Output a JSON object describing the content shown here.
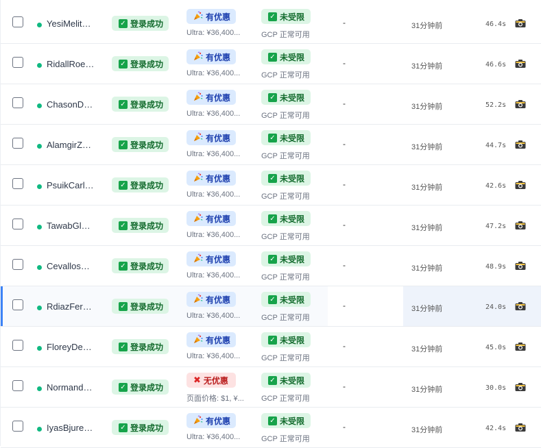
{
  "columns": {
    "login_icon": "check-icon",
    "promo_icon": "party-popper-icon",
    "nopromo_icon": "cross-mark-icon",
    "limit_icon": "check-icon",
    "screenshot_icon": "camera-icon"
  },
  "colors": {
    "status_dot": "#10b981",
    "success_bg": "#dcf5e5",
    "success_text": "#146c2e",
    "promo_bg": "#dbeafe",
    "promo_text": "#1e40af",
    "nopromo_bg": "#fde2e2",
    "nopromo_text": "#b91c1c",
    "selected_bar": "#3b82f6"
  },
  "rows": [
    {
      "name": "YesiMelit…",
      "login": "登录成功",
      "promo": "有优惠",
      "has_promo": true,
      "price": "Ultra: ¥36,400...",
      "limit": "未受限",
      "gcp": "GCP 正常可用",
      "dash": "-",
      "time": "31分钟前",
      "duration": "46.4s",
      "selected": false
    },
    {
      "name": "RidallRoe…",
      "login": "登录成功",
      "promo": "有优惠",
      "has_promo": true,
      "price": "Ultra: ¥36,400...",
      "limit": "未受限",
      "gcp": "GCP 正常可用",
      "dash": "-",
      "time": "31分钟前",
      "duration": "46.6s",
      "selected": false
    },
    {
      "name": "ChasonD…",
      "login": "登录成功",
      "promo": "有优惠",
      "has_promo": true,
      "price": "Ultra: ¥36,400...",
      "limit": "未受限",
      "gcp": "GCP 正常可用",
      "dash": "-",
      "time": "31分钟前",
      "duration": "52.2s",
      "selected": false
    },
    {
      "name": "AlamgirZ…",
      "login": "登录成功",
      "promo": "有优惠",
      "has_promo": true,
      "price": "Ultra: ¥36,400...",
      "limit": "未受限",
      "gcp": "GCP 正常可用",
      "dash": "-",
      "time": "31分钟前",
      "duration": "44.7s",
      "selected": false
    },
    {
      "name": "PsuikCarl…",
      "login": "登录成功",
      "promo": "有优惠",
      "has_promo": true,
      "price": "Ultra: ¥36,400...",
      "limit": "未受限",
      "gcp": "GCP 正常可用",
      "dash": "-",
      "time": "31分钟前",
      "duration": "42.6s",
      "selected": false
    },
    {
      "name": "TawabGl…",
      "login": "登录成功",
      "promo": "有优惠",
      "has_promo": true,
      "price": "Ultra: ¥36,400...",
      "limit": "未受限",
      "gcp": "GCP 正常可用",
      "dash": "-",
      "time": "31分钟前",
      "duration": "47.2s",
      "selected": false
    },
    {
      "name": "Cevallos…",
      "login": "登录成功",
      "promo": "有优惠",
      "has_promo": true,
      "price": "Ultra: ¥36,400...",
      "limit": "未受限",
      "gcp": "GCP 正常可用",
      "dash": "-",
      "time": "31分钟前",
      "duration": "48.9s",
      "selected": false
    },
    {
      "name": "RdiazFer…",
      "login": "登录成功",
      "promo": "有优惠",
      "has_promo": true,
      "price": "Ultra: ¥36,400...",
      "limit": "未受限",
      "gcp": "GCP 正常可用",
      "dash": "-",
      "time": "31分钟前",
      "duration": "24.0s",
      "selected": true
    },
    {
      "name": "FloreyDe…",
      "login": "登录成功",
      "promo": "有优惠",
      "has_promo": true,
      "price": "Ultra: ¥36,400...",
      "limit": "未受限",
      "gcp": "GCP 正常可用",
      "dash": "-",
      "time": "31分钟前",
      "duration": "45.0s",
      "selected": false
    },
    {
      "name": "Normand…",
      "login": "登录成功",
      "promo": "无优惠",
      "has_promo": false,
      "price": "页面价格: $1, ¥...",
      "limit": "未受限",
      "gcp": "GCP 正常可用",
      "dash": "-",
      "time": "31分钟前",
      "duration": "30.0s",
      "selected": false
    },
    {
      "name": "IyasBjure…",
      "login": "登录成功",
      "promo": "有优惠",
      "has_promo": true,
      "price": "Ultra: ¥36,400...",
      "limit": "未受限",
      "gcp": "GCP 正常可用",
      "dash": "-",
      "time": "31分钟前",
      "duration": "42.4s",
      "selected": false
    }
  ]
}
